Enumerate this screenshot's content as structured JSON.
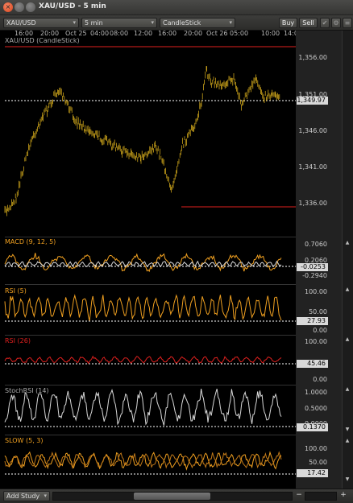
{
  "window": {
    "title": "XAU/USD - 5 min",
    "close_glyph": "×"
  },
  "toolbar": {
    "symbol": "XAU/USD",
    "interval": "5 min",
    "chart_type": "CandleStick",
    "buy_label": "Buy",
    "sell_label": "Sell"
  },
  "icons": {
    "dropdown": "chevron-down-icon",
    "close": "close-icon",
    "settings": "gear-icon",
    "expand": "expand-icon"
  },
  "colors": {
    "price": "#e5b81e",
    "macd": "#f0a020",
    "signal": "#d8d8d8",
    "rsi5": "#f0a020",
    "rsi26": "#e0201e",
    "stochrsi": "#d8d8d8",
    "slow": "#f0a020",
    "resistance": "#e0201e"
  },
  "time_axis": [
    "16:00",
    "20:00",
    "Oct 25",
    "04:00",
    "08:00",
    "12:00",
    "16:00",
    "20:00",
    "Oct 26",
    "05:00",
    "10:00",
    "14:0"
  ],
  "price_pane": {
    "label": "XAU/USD (CandleStick)",
    "ticks": [
      "1,356.00",
      "1,351.00",
      "1,346.00",
      "1,341.00",
      "1,336.00"
    ],
    "last": "1,349.97"
  },
  "macd": {
    "label": "MACD (9, 12, 5)",
    "ticks": [
      "0.7060",
      "0.2060",
      "-0.2940"
    ],
    "last": "-0.0253"
  },
  "rsi5": {
    "label": "RSI (5)",
    "ticks": [
      "100.00",
      "50.00",
      "0.00"
    ],
    "last": "27.93"
  },
  "rsi26": {
    "label": "RSI (26)",
    "ticks": [
      "100.00",
      "0.00"
    ],
    "last": "45.46"
  },
  "stochrsi": {
    "label": "StochRSI (14)",
    "ticks": [
      "1.0000",
      "0.5000",
      "0.0000"
    ],
    "last": "0.1370"
  },
  "slow": {
    "label": "SLOW (5, 3)",
    "ticks": [
      "100.00",
      "50.00"
    ],
    "last": "17.42"
  },
  "bottom": {
    "add_study": "Add Study",
    "minus": "−",
    "plus": "+"
  }
}
